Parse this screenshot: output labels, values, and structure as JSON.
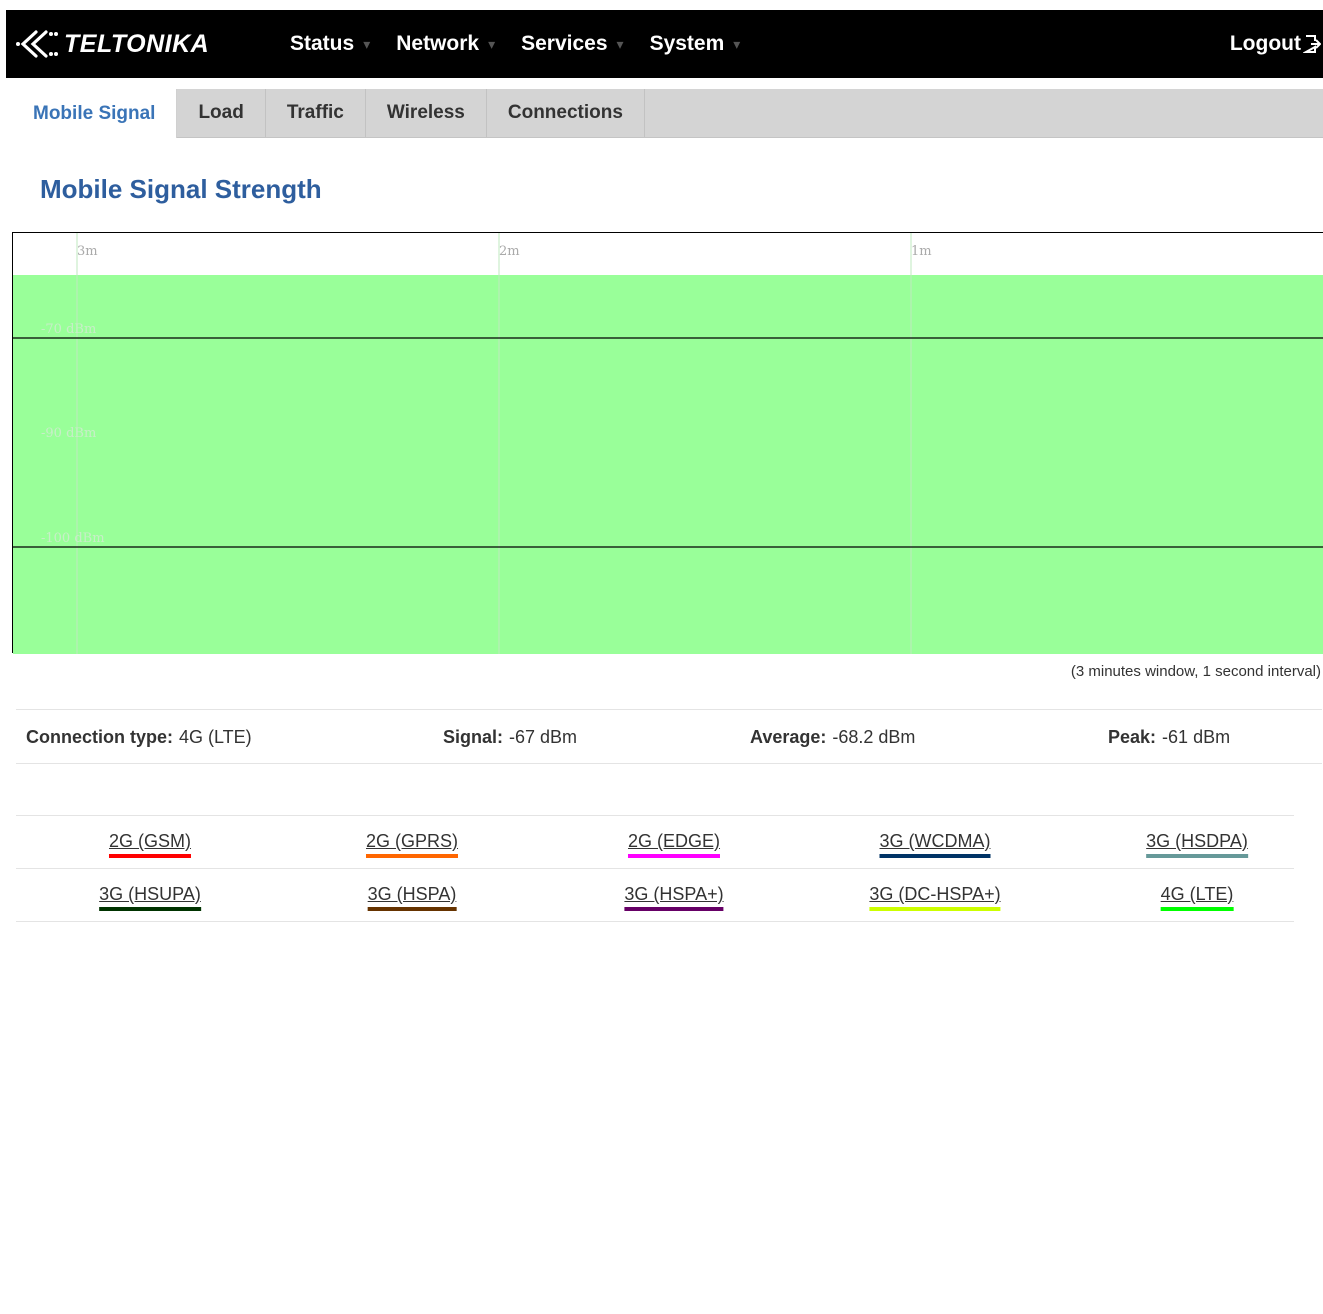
{
  "brand": {
    "name": "TELTONIKA"
  },
  "nav": {
    "items": [
      {
        "label": "Status"
      },
      {
        "label": "Network"
      },
      {
        "label": "Services"
      },
      {
        "label": "System"
      }
    ],
    "logout": "Logout"
  },
  "tabs": [
    {
      "label": "Mobile Signal",
      "active": true
    },
    {
      "label": "Load",
      "active": false
    },
    {
      "label": "Traffic",
      "active": false
    },
    {
      "label": "Wireless",
      "active": false
    },
    {
      "label": "Connections",
      "active": false
    }
  ],
  "page": {
    "title": "Mobile Signal Strength"
  },
  "chart_data": {
    "type": "area",
    "x_ticks": [
      "3m",
      "2m",
      "1m"
    ],
    "y_ticks": [
      "-70 dBm",
      "-90 dBm",
      "-100 dBm"
    ],
    "fill_color": "#99ff99",
    "grid": true,
    "note": "(3 minutes window, 1 second interval)"
  },
  "stats": {
    "connection_type_label": "Connection type:",
    "connection_type_value": "4G (LTE)",
    "signal_label": "Signal:",
    "signal_value": "-67 dBm",
    "average_label": "Average:",
    "average_value": "-68.2 dBm",
    "peak_label": "Peak:",
    "peak_value": "-61 dBm"
  },
  "legend": {
    "rows": [
      [
        {
          "label": "2G (GSM)",
          "color": "#ff0000"
        },
        {
          "label": "2G (GPRS)",
          "color": "#ff6600"
        },
        {
          "label": "2G (EDGE)",
          "color": "#ff00ff"
        },
        {
          "label": "3G (WCDMA)",
          "color": "#003366"
        },
        {
          "label": "3G (HSDPA)",
          "color": "#669999"
        }
      ],
      [
        {
          "label": "3G (HSUPA)",
          "color": "#003300"
        },
        {
          "label": "3G (HSPA)",
          "color": "#663300"
        },
        {
          "label": "3G (HSPA+)",
          "color": "#660066"
        },
        {
          "label": "3G (DC-HSPA+)",
          "color": "#ccff00"
        },
        {
          "label": "4G (LTE)",
          "color": "#00ff00"
        }
      ]
    ]
  }
}
